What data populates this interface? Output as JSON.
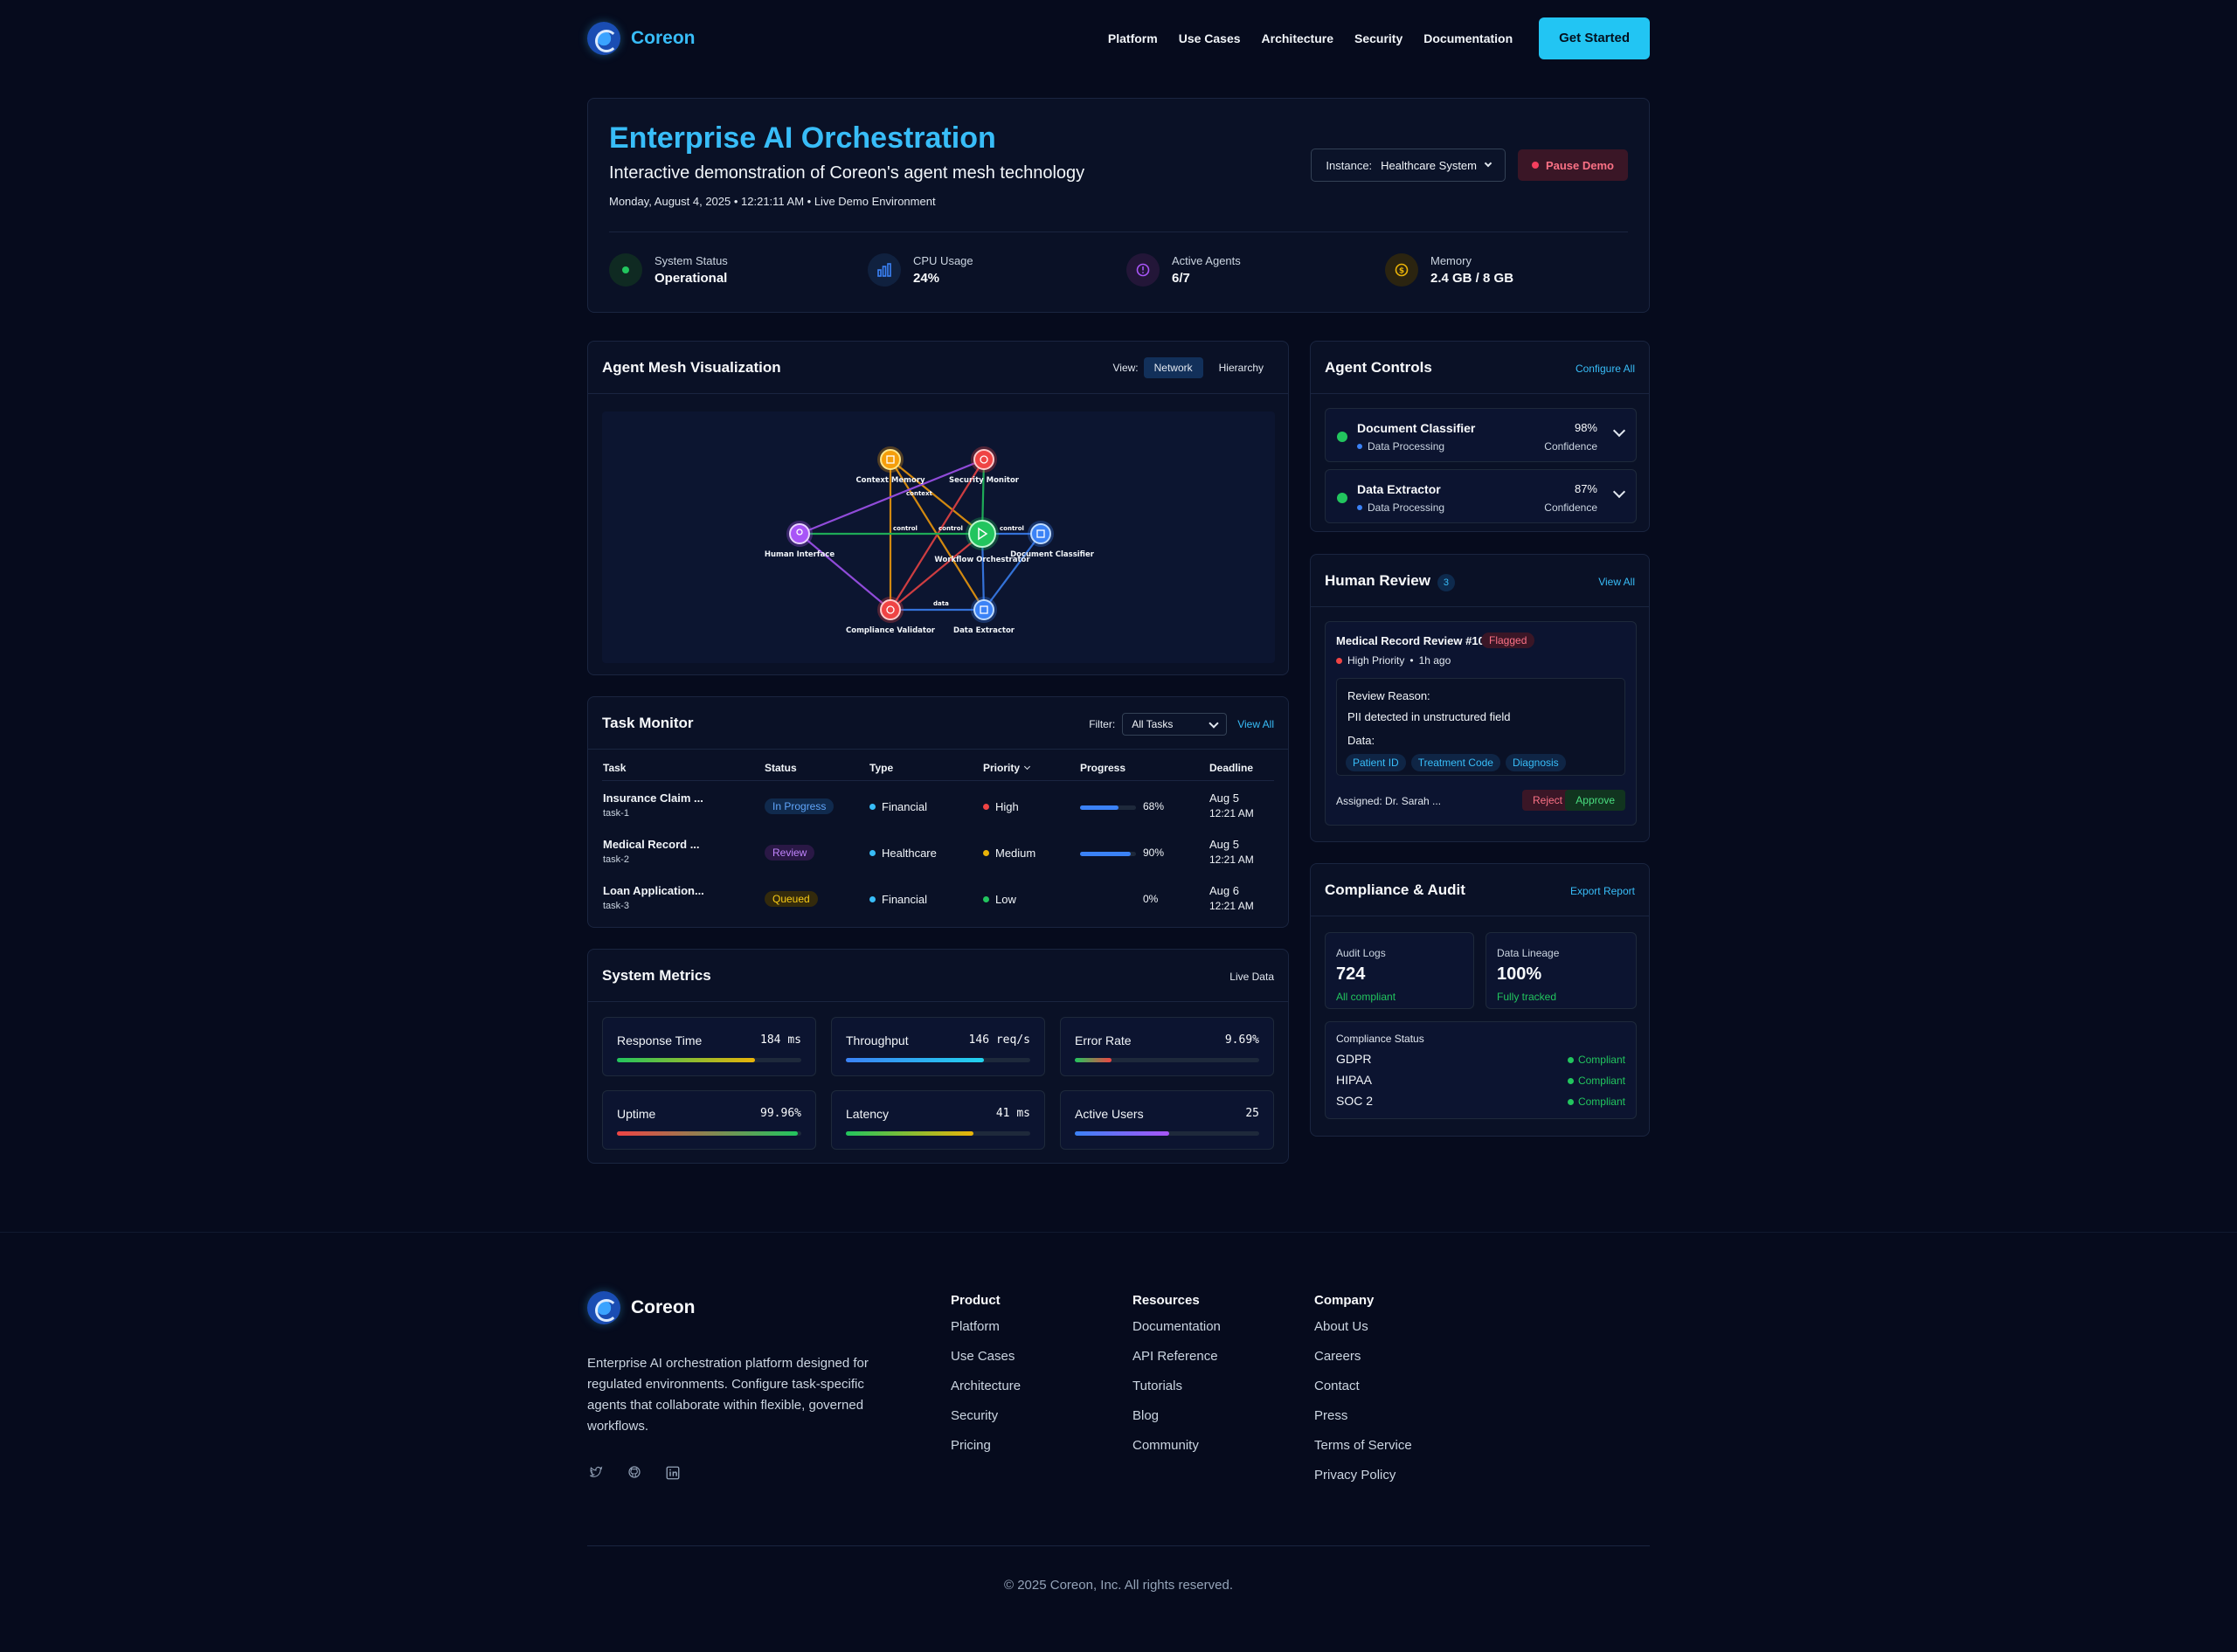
{
  "nav": {
    "brand": "Coreon",
    "links": [
      "Platform",
      "Use Cases",
      "Architecture",
      "Security",
      "Documentation"
    ],
    "cta": "Get Started"
  },
  "hero": {
    "title": "Enterprise AI Orchestration",
    "subtitle": "Interactive demonstration of Coreon's agent mesh technology",
    "datetime": "Monday, August 4, 2025 • 12:21:11 AM • Live Demo Environment",
    "instance_label": "Instance:",
    "instance_value": "Healthcare System",
    "pause_label": "Pause Demo",
    "stats": [
      {
        "label": "System Status",
        "value": "Operational",
        "icon": "status-dot-icon",
        "color": "#22c55e"
      },
      {
        "label": "CPU Usage",
        "value": "24%",
        "icon": "bar-chart-icon",
        "color": "#3b82f6"
      },
      {
        "label": "Active Agents",
        "value": "6/7",
        "icon": "clock-icon",
        "color": "#a855f7"
      },
      {
        "label": "Memory",
        "value": "2.4 GB / 8 GB",
        "icon": "dollar-icon",
        "color": "#eab308"
      }
    ]
  },
  "mesh": {
    "title": "Agent Mesh Visualization",
    "view_label": "View:",
    "view_options": [
      "Network",
      "Hierarchy"
    ],
    "selected_view": "Network",
    "nodes": [
      {
        "label": "Context Memory",
        "color": "#f59e0b"
      },
      {
        "label": "Security Monitor",
        "color": "#ef4444"
      },
      {
        "label": "Human Interface",
        "color": "#a855f7"
      },
      {
        "label": "Workflow Orchestrator",
        "color": "#22c55e"
      },
      {
        "label": "Document Classifier",
        "color": "#3b82f6"
      },
      {
        "label": "Compliance Validator",
        "color": "#ef4444"
      },
      {
        "label": "Data Extractor",
        "color": "#3b82f6"
      }
    ],
    "edge_labels": [
      "context",
      "control",
      "control",
      "control",
      "data"
    ]
  },
  "controls": {
    "title": "Agent Controls",
    "configure": "Configure All",
    "agents": [
      {
        "name": "Document Classifier",
        "category": "Data Processing",
        "confidence": "98%",
        "confidence_label": "Confidence"
      },
      {
        "name": "Data Extractor",
        "category": "Data Processing",
        "confidence": "87%",
        "confidence_label": "Confidence"
      }
    ]
  },
  "review": {
    "title": "Human Review",
    "count": "3",
    "view_all": "View All",
    "item_title": "Medical Record Review #103",
    "flag": "Flagged",
    "priority": "High Priority",
    "age": "1h ago",
    "reason_label": "Review Reason:",
    "reason": "PII detected in unstructured field",
    "data_label": "Data:",
    "chips": [
      "Patient ID",
      "Treatment Code",
      "Diagnosis"
    ],
    "assigned": "Assigned: Dr. Sarah ...",
    "reject": "Reject",
    "approve": "Approve"
  },
  "tasks": {
    "title": "Task Monitor",
    "filter_label": "Filter:",
    "filter_value": "All Tasks",
    "view_all": "View All",
    "headers": [
      "Task",
      "Status",
      "Type",
      "Priority",
      "Progress",
      "Deadline"
    ],
    "rows": [
      {
        "name": "Insurance Claim ...",
        "id": "task-1",
        "status": "In Progress",
        "type": "Financial",
        "priority": "High",
        "progress": "68%",
        "progress_value": 0.68,
        "deadline_date": "Aug 5",
        "deadline_time": "12:21 AM"
      },
      {
        "name": "Medical Record ...",
        "id": "task-2",
        "status": "Review",
        "type": "Healthcare",
        "priority": "Medium",
        "progress": "90%",
        "progress_value": 0.9,
        "deadline_date": "Aug 5",
        "deadline_time": "12:21 AM"
      },
      {
        "name": "Loan Application...",
        "id": "task-3",
        "status": "Queued",
        "type": "Financial",
        "priority": "Low",
        "progress": "0%",
        "progress_value": 0,
        "deadline_date": "Aug 6",
        "deadline_time": "12:21 AM"
      }
    ]
  },
  "compliance": {
    "title": "Compliance & Audit",
    "export": "Export Report",
    "audit_label": "Audit Logs",
    "audit_value": "724",
    "audit_sub": "All compliant",
    "lineage_label": "Data Lineage",
    "lineage_value": "100%",
    "lineage_sub": "Fully tracked",
    "status_label": "Compliance Status",
    "items": [
      {
        "name": "GDPR",
        "status": "Compliant"
      },
      {
        "name": "HIPAA",
        "status": "Compliant"
      },
      {
        "name": "SOC 2",
        "status": "Compliant"
      }
    ]
  },
  "metrics": {
    "title": "System Metrics",
    "live": "Live Data",
    "items": [
      {
        "label": "Response Time",
        "value": "184 ms",
        "fill": 0.75
      },
      {
        "label": "Throughput",
        "value": "146 req/s",
        "fill": 0.75
      },
      {
        "label": "Error Rate",
        "value": "9.69%",
        "fill": 0.2
      },
      {
        "label": "Uptime",
        "value": "99.96%",
        "fill": 0.98
      },
      {
        "label": "Latency",
        "value": "41 ms",
        "fill": 0.69
      },
      {
        "label": "Active Users",
        "value": "25",
        "fill": 0.51
      }
    ]
  },
  "footer": {
    "brand": "Coreon",
    "description": "Enterprise AI orchestration platform designed for regulated environments. Configure task-specific agents that collaborate within flexible, governed workflows.",
    "columns": [
      {
        "title": "Product",
        "links": [
          "Platform",
          "Use Cases",
          "Architecture",
          "Security",
          "Pricing"
        ]
      },
      {
        "title": "Resources",
        "links": [
          "Documentation",
          "API Reference",
          "Tutorials",
          "Blog",
          "Community"
        ]
      },
      {
        "title": "Company",
        "links": [
          "About Us",
          "Careers",
          "Contact",
          "Press",
          "Terms of Service",
          "Privacy Policy"
        ]
      }
    ],
    "social": [
      "twitter-icon",
      "github-icon",
      "linkedin-icon"
    ],
    "copyright": "© 2025 Coreon, Inc. All rights reserved."
  }
}
